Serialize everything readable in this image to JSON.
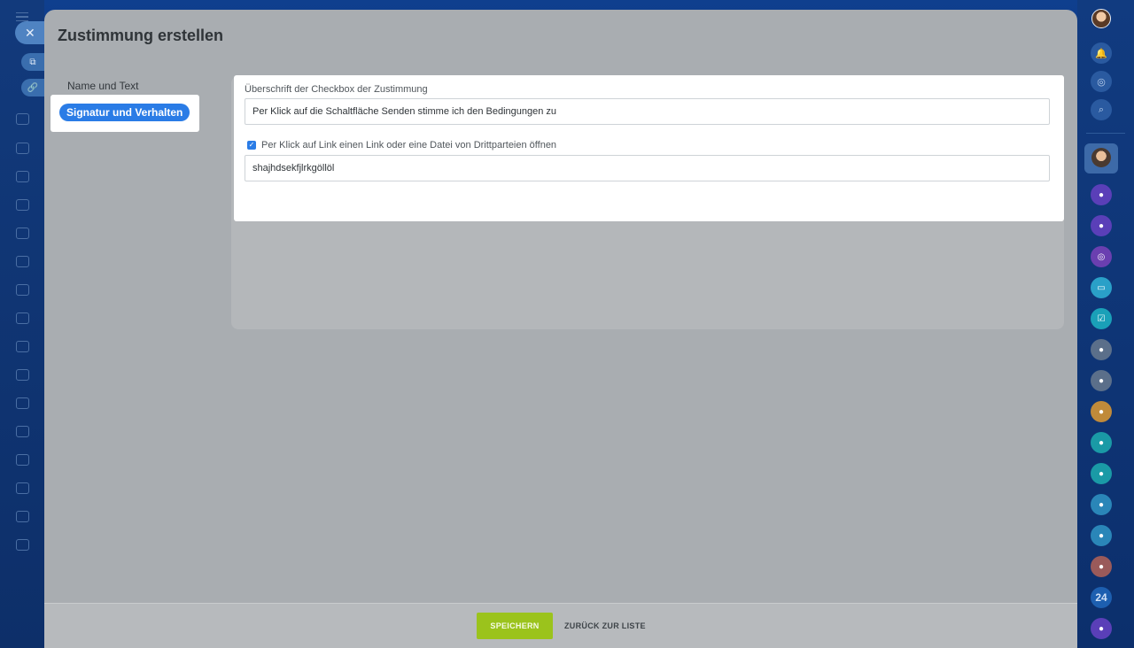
{
  "page": {
    "title": "Zustimmung erstellen"
  },
  "nav": {
    "items": [
      {
        "label": "Name und Text",
        "active": false
      },
      {
        "label": "Signatur und Verhalten",
        "active": true
      }
    ]
  },
  "form": {
    "heading_label": "Überschrift der Checkbox der Zustimmung",
    "heading_value": "Per Klick auf die Schaltfläche Senden stimme ich den Bedingungen zu",
    "link_checkbox_label": "Per Klick auf Link einen Link oder eine Datei von Drittparteien öffnen",
    "link_checkbox_checked": true,
    "link_value": "shajhdsekfjlrkgöllöl"
  },
  "footer": {
    "save_label": "SPEICHERN",
    "back_label": "ZURÜCK ZUR LISTE"
  },
  "right_rail": {
    "badge_label": "24"
  },
  "colors": {
    "accent": "#2a7ce6",
    "save": "#9bc31c",
    "rail": "#0c2f6c"
  },
  "icons": [
    "close-icon",
    "open-new-icon",
    "link-icon",
    "bell-icon",
    "pulse-icon",
    "search-icon",
    "check-icon"
  ]
}
